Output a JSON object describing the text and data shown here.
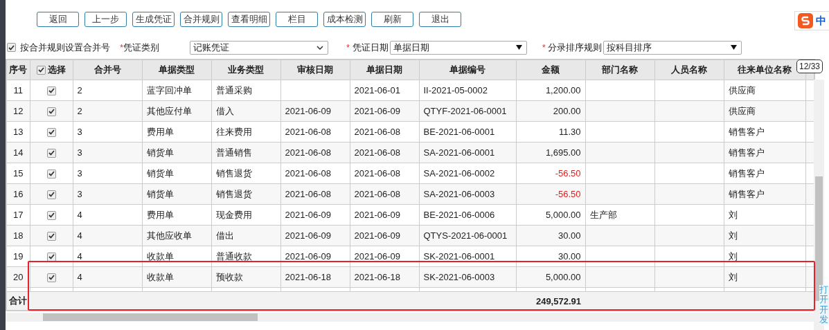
{
  "toolbar": {
    "buttons": [
      "返回",
      "上一步",
      "生成凭证",
      "合并规则",
      "查看明细",
      "栏目",
      "成本检测",
      "刷新",
      "退出"
    ]
  },
  "ime_badge": {
    "label": "中"
  },
  "options": {
    "merge_by_rule": {
      "label": "按合并规则设置合并号",
      "checked": true
    },
    "voucher_type": {
      "mark": "*",
      "label": "凭证类别",
      "value": "记账凭证"
    },
    "voucher_date": {
      "mark": "*",
      "label": "凭证日期",
      "value": "单据日期"
    },
    "entry_sort": {
      "mark": "*",
      "label": "分录排序规则",
      "value": "按科目排序"
    }
  },
  "table": {
    "columns": [
      "序号",
      "选择",
      "合并号",
      "单据类型",
      "业务类型",
      "审核日期",
      "单据日期",
      "单据编号",
      "金额",
      "部门名称",
      "人员名称",
      "往来单位名称"
    ],
    "select_all": true,
    "page_badge": "12/33",
    "rows": [
      {
        "cells": [
          "11",
          "",
          "2",
          "蓝字回冲单",
          "普通采购",
          "",
          "2021-06-01",
          "II-2021-05-0002",
          "1,200.00",
          "",
          "",
          "供应商"
        ],
        "selected": true,
        "negative": false
      },
      {
        "cells": [
          "12",
          "",
          "2",
          "其他应付单",
          "借入",
          "2021-06-09",
          "2021-06-09",
          "QTYF-2021-06-0001",
          "200.00",
          "",
          "",
          "供应商"
        ],
        "selected": true,
        "negative": false
      },
      {
        "cells": [
          "13",
          "",
          "3",
          "费用单",
          "往来费用",
          "2021-06-08",
          "2021-06-08",
          "BE-2021-06-0001",
          "11.30",
          "",
          "",
          "销售客户"
        ],
        "selected": true,
        "negative": false
      },
      {
        "cells": [
          "14",
          "",
          "3",
          "销货单",
          "普通销售",
          "2021-06-08",
          "2021-06-08",
          "SA-2021-06-0001",
          "1,695.00",
          "",
          "",
          "销售客户"
        ],
        "selected": true,
        "negative": false
      },
      {
        "cells": [
          "15",
          "",
          "3",
          "销货单",
          "销售退货",
          "2021-06-08",
          "2021-06-08",
          "SA-2021-06-0002",
          "-56.50",
          "",
          "",
          "销售客户"
        ],
        "selected": true,
        "negative": true
      },
      {
        "cells": [
          "16",
          "",
          "3",
          "销货单",
          "销售退货",
          "2021-06-08",
          "2021-06-08",
          "SA-2021-06-0003",
          "-56.50",
          "",
          "",
          "销售客户"
        ],
        "selected": true,
        "negative": true
      },
      {
        "cells": [
          "17",
          "",
          "4",
          "费用单",
          "现金费用",
          "2021-06-09",
          "2021-06-09",
          "BE-2021-06-0006",
          "5,000.00",
          "生产部",
          "",
          "刘"
        ],
        "selected": true,
        "negative": false
      },
      {
        "cells": [
          "18",
          "",
          "4",
          "其他应收单",
          "借出",
          "2021-06-09",
          "2021-06-09",
          "QTYS-2021-06-0001",
          "30.00",
          "",
          "",
          "刘"
        ],
        "selected": true,
        "negative": false
      },
      {
        "cells": [
          "19",
          "",
          "4",
          "收款单",
          "普通收款",
          "2021-06-09",
          "2021-06-09",
          "SK-2021-06-0001",
          "30.00",
          "",
          "",
          "刘"
        ],
        "selected": true,
        "negative": false
      },
      {
        "cells": [
          "20",
          "",
          "4",
          "收款单",
          "预收款",
          "2021-06-18",
          "2021-06-18",
          "SK-2021-06-0003",
          "5,000.00",
          "",
          "",
          "刘"
        ],
        "selected": true,
        "negative": false
      }
    ],
    "total": {
      "label": "合计",
      "amount": "249,572.91"
    }
  },
  "side_tab": {
    "label": "打开开发"
  }
}
